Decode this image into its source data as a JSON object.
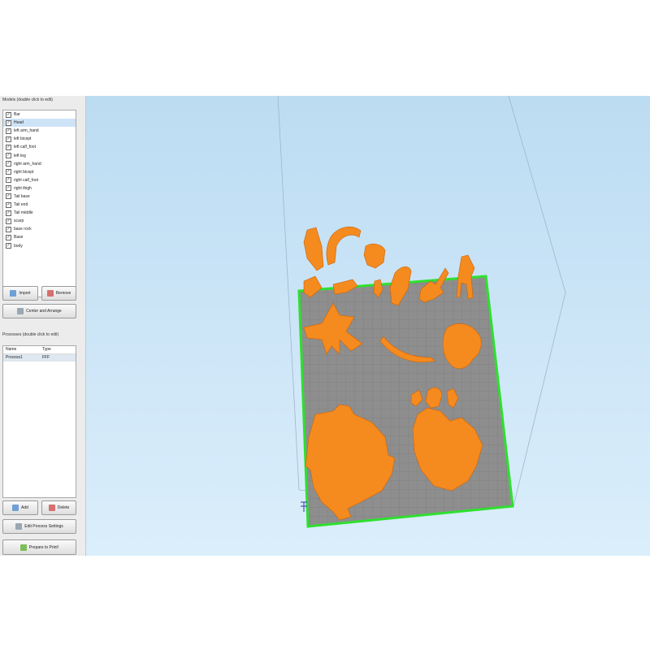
{
  "models": {
    "title": "Models (double click to edit)",
    "items": [
      {
        "label": "Bar",
        "checked": true
      },
      {
        "label": "Head",
        "checked": true,
        "selected": true
      },
      {
        "label": "left arm_hand",
        "checked": true
      },
      {
        "label": "left bicept",
        "checked": true
      },
      {
        "label": "left calf_foot",
        "checked": true
      },
      {
        "label": "left leg",
        "checked": true
      },
      {
        "label": "right arm_hand",
        "checked": true
      },
      {
        "label": "right bicept",
        "checked": true
      },
      {
        "label": "right calf_foot",
        "checked": true
      },
      {
        "label": "right thigh",
        "checked": true
      },
      {
        "label": "Tail base",
        "checked": true
      },
      {
        "label": "Tail end",
        "checked": true
      },
      {
        "label": "Tail middle",
        "checked": true
      },
      {
        "label": "scarp",
        "checked": true
      },
      {
        "label": "base rock",
        "checked": true
      },
      {
        "label": "Base",
        "checked": true
      },
      {
        "label": "body",
        "checked": true
      }
    ],
    "import_label": "Import",
    "remove_label": "Remove",
    "center_label": "Center and Arrange"
  },
  "processes": {
    "title": "Processes (double click to edit)",
    "columns": [
      "Name",
      "Type"
    ],
    "rows": [
      {
        "name": "Process1",
        "type": "FFF"
      }
    ],
    "add_label": "Add",
    "delete_label": "Delete",
    "edit_label": "Edit Process Settings",
    "prepare_label": "Prepare to Print!"
  },
  "colors": {
    "model": "#f58a1f",
    "bed": "#8e8e8e",
    "bed_border": "#2ee02e",
    "viewport_top": "#bcdcf2"
  },
  "icons": {
    "import": "import-icon",
    "remove": "remove-icon",
    "center": "center-arrange-icon",
    "add": "add-icon",
    "delete": "delete-icon",
    "edit": "edit-settings-icon",
    "prepare": "prepare-print-icon",
    "axis": "axis-icon"
  }
}
